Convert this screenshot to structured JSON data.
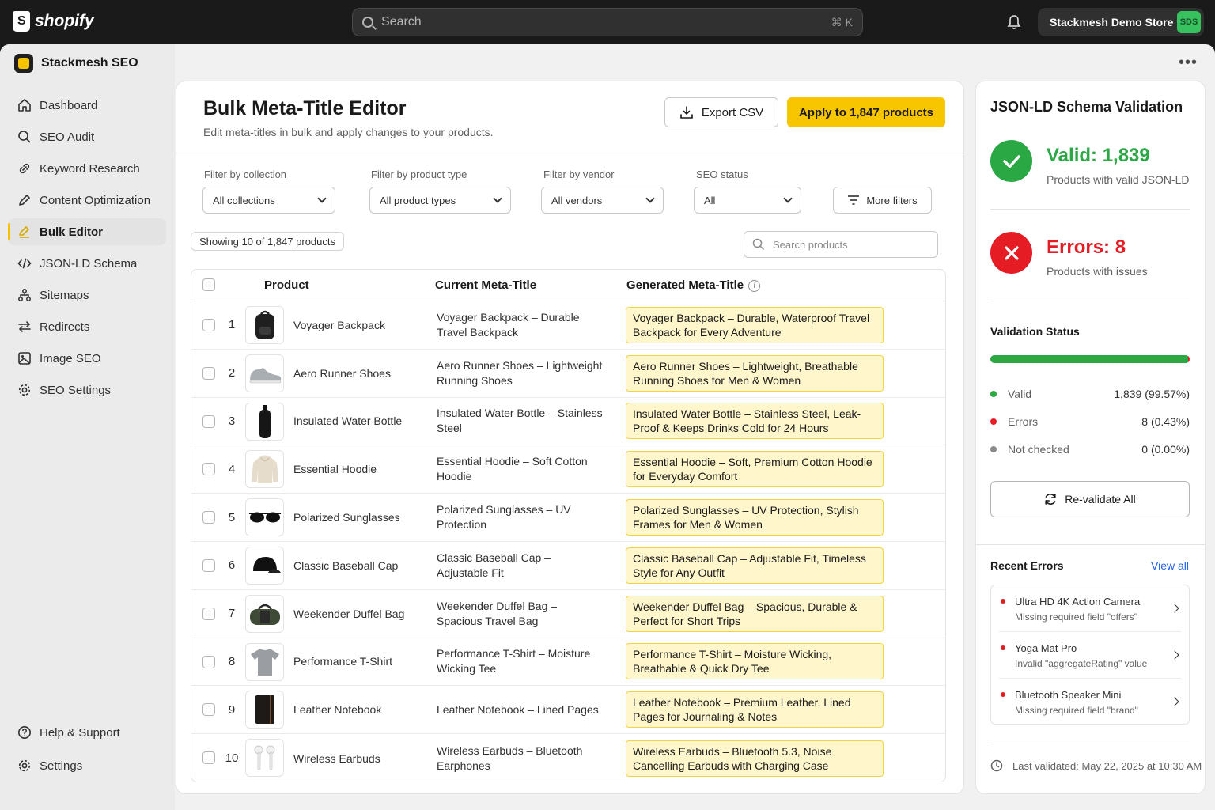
{
  "topbar": {
    "brand": "shopify",
    "search_placeholder": "Search",
    "search_shortcut": "⌘ K",
    "store_name": "Stackmesh Demo Store",
    "store_initials": "SDS"
  },
  "app": {
    "name": "Stackmesh SEO"
  },
  "sidebar": {
    "items": [
      {
        "label": "Dashboard",
        "icon": "home-icon"
      },
      {
        "label": "SEO Audit",
        "icon": "search-icon"
      },
      {
        "label": "Keyword Research",
        "icon": "link-icon"
      },
      {
        "label": "Content Optimization",
        "icon": "pencil-icon"
      },
      {
        "label": "Bulk Editor",
        "icon": "edit-icon",
        "active": true
      },
      {
        "label": "JSON-LD Schema",
        "icon": "code-icon"
      },
      {
        "label": "Sitemaps",
        "icon": "sitemap-icon"
      },
      {
        "label": "Redirects",
        "icon": "arrows-icon"
      },
      {
        "label": "Image SEO",
        "icon": "image-icon"
      },
      {
        "label": "SEO Settings",
        "icon": "gear-icon"
      }
    ],
    "bottom": [
      {
        "label": "Help & Support",
        "icon": "help-icon"
      },
      {
        "label": "Settings",
        "icon": "gear-icon"
      }
    ]
  },
  "main": {
    "title": "Bulk Meta-Title Editor",
    "subtitle": "Edit meta-titles in bulk and apply changes to your products.",
    "export_label": "Export CSV",
    "apply_label": "Apply to 1,847 products",
    "filters": [
      {
        "label": "Filter by collection",
        "value": "All collections"
      },
      {
        "label": "Filter by product type",
        "value": "All product types"
      },
      {
        "label": "Filter by vendor",
        "value": "All vendors"
      },
      {
        "label": "SEO status",
        "value": "All"
      }
    ],
    "more_filters_label": "More filters",
    "showing_label": "Showing 10 of 1,847 products",
    "search_placeholder": "Search products",
    "columns": {
      "product": "Product",
      "current": "Current Meta-Title",
      "generated": "Generated Meta-Title"
    },
    "rows": [
      {
        "num": "1",
        "product": "Voyager Backpack",
        "current": "Voyager Backpack – Durable Travel Backpack",
        "generated": "Voyager Backpack – Durable, Waterproof Travel Backpack for Every Adventure"
      },
      {
        "num": "2",
        "product": "Aero Runner Shoes",
        "current": "Aero Runner Shoes – Lightweight Running Shoes",
        "generated": "Aero Runner Shoes – Lightweight, Breathable Running Shoes for Men & Women"
      },
      {
        "num": "3",
        "product": "Insulated Water Bottle",
        "current": "Insulated Water Bottle – Stainless Steel",
        "generated": "Insulated Water Bottle – Stainless Steel, Leak-Proof & Keeps Drinks Cold for 24 Hours"
      },
      {
        "num": "4",
        "product": "Essential Hoodie",
        "current": "Essential Hoodie – Soft Cotton Hoodie",
        "generated": "Essential Hoodie – Soft, Premium Cotton Hoodie for Everyday Comfort"
      },
      {
        "num": "5",
        "product": "Polarized Sunglasses",
        "current": "Polarized Sunglasses – UV Protection",
        "generated": "Polarized Sunglasses – UV Protection, Stylish Frames for Men & Women"
      },
      {
        "num": "6",
        "product": "Classic Baseball Cap",
        "current": "Classic Baseball Cap – Adjustable Fit",
        "generated": "Classic Baseball Cap – Adjustable Fit, Timeless Style for Any Outfit"
      },
      {
        "num": "7",
        "product": "Weekender Duffel Bag",
        "current": "Weekender Duffel Bag – Spacious Travel Bag",
        "generated": "Weekender Duffel Bag – Spacious, Durable & Perfect for Short Trips"
      },
      {
        "num": "8",
        "product": "Performance T-Shirt",
        "current": "Performance T-Shirt – Moisture Wicking Tee",
        "generated": "Performance T-Shirt – Moisture Wicking, Breathable & Quick Dry Tee"
      },
      {
        "num": "9",
        "product": "Leather Notebook",
        "current": "Leather Notebook – Lined Pages",
        "generated": "Leather Notebook – Premium Leather, Lined Pages for Journaling & Notes"
      },
      {
        "num": "10",
        "product": "Wireless Earbuds",
        "current": "Wireless Earbuds – Bluetooth Earphones",
        "generated": "Wireless Earbuds – Bluetooth 5.3, Noise Cancelling Earbuds with Charging Case"
      }
    ]
  },
  "validation": {
    "title": "JSON-LD Schema Validation",
    "valid_big": "Valid: 1,839",
    "valid_sub": "Products with valid JSON-LD",
    "errors_big": "Errors: 8",
    "errors_sub": "Products with issues",
    "status_title": "Validation Status",
    "valid_fraction": 0.9957,
    "error_fraction": 0.0043,
    "legend": [
      {
        "label": "Valid",
        "value": "1,839 (99.57%)",
        "color": "#29a844"
      },
      {
        "label": "Errors",
        "value": "8 (0.43%)",
        "color": "#e51c23"
      },
      {
        "label": "Not checked",
        "value": "0 (0.00%)",
        "color": "#8a8a8a"
      }
    ],
    "revalidate_label": "Re-validate All",
    "recent_title": "Recent Errors",
    "view_all": "View all",
    "recent_errors": [
      {
        "name": "Ultra HD 4K Action Camera",
        "desc": "Missing required field \"offers\""
      },
      {
        "name": "Yoga Mat Pro",
        "desc": "Invalid \"aggregateRating\" value"
      },
      {
        "name": "Bluetooth Speaker Mini",
        "desc": "Missing required field \"brand\""
      }
    ],
    "last_validated": "Last validated: May 22, 2025 at 10:30 AM"
  },
  "colors": {
    "accent": "#f7c600",
    "valid": "#29a844",
    "error": "#e51c23",
    "link": "#2463eb"
  }
}
